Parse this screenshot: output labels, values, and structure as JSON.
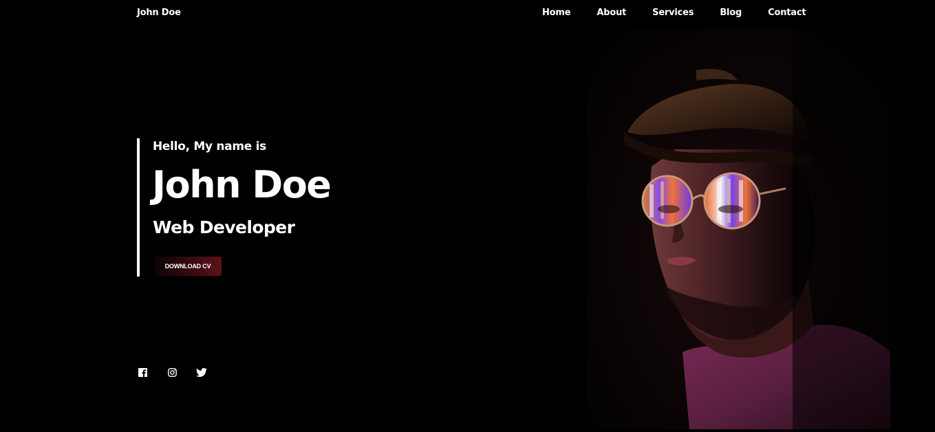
{
  "nav": {
    "brand": "John Doe",
    "links": [
      "Home",
      "About",
      "Services",
      "Blog",
      "Contact"
    ]
  },
  "hero": {
    "greeting": "Hello, My name is",
    "name": "John Doe",
    "role": "Web Developer",
    "cv_button": "DOWNLOAD CV"
  },
  "social": {
    "icons": [
      "facebook-icon",
      "instagram-icon",
      "twitter-icon"
    ]
  },
  "colors": {
    "background": "#000000",
    "text": "#ffffff",
    "button_gradient_start": "#0d0303",
    "button_gradient_end": "#5c121a"
  }
}
